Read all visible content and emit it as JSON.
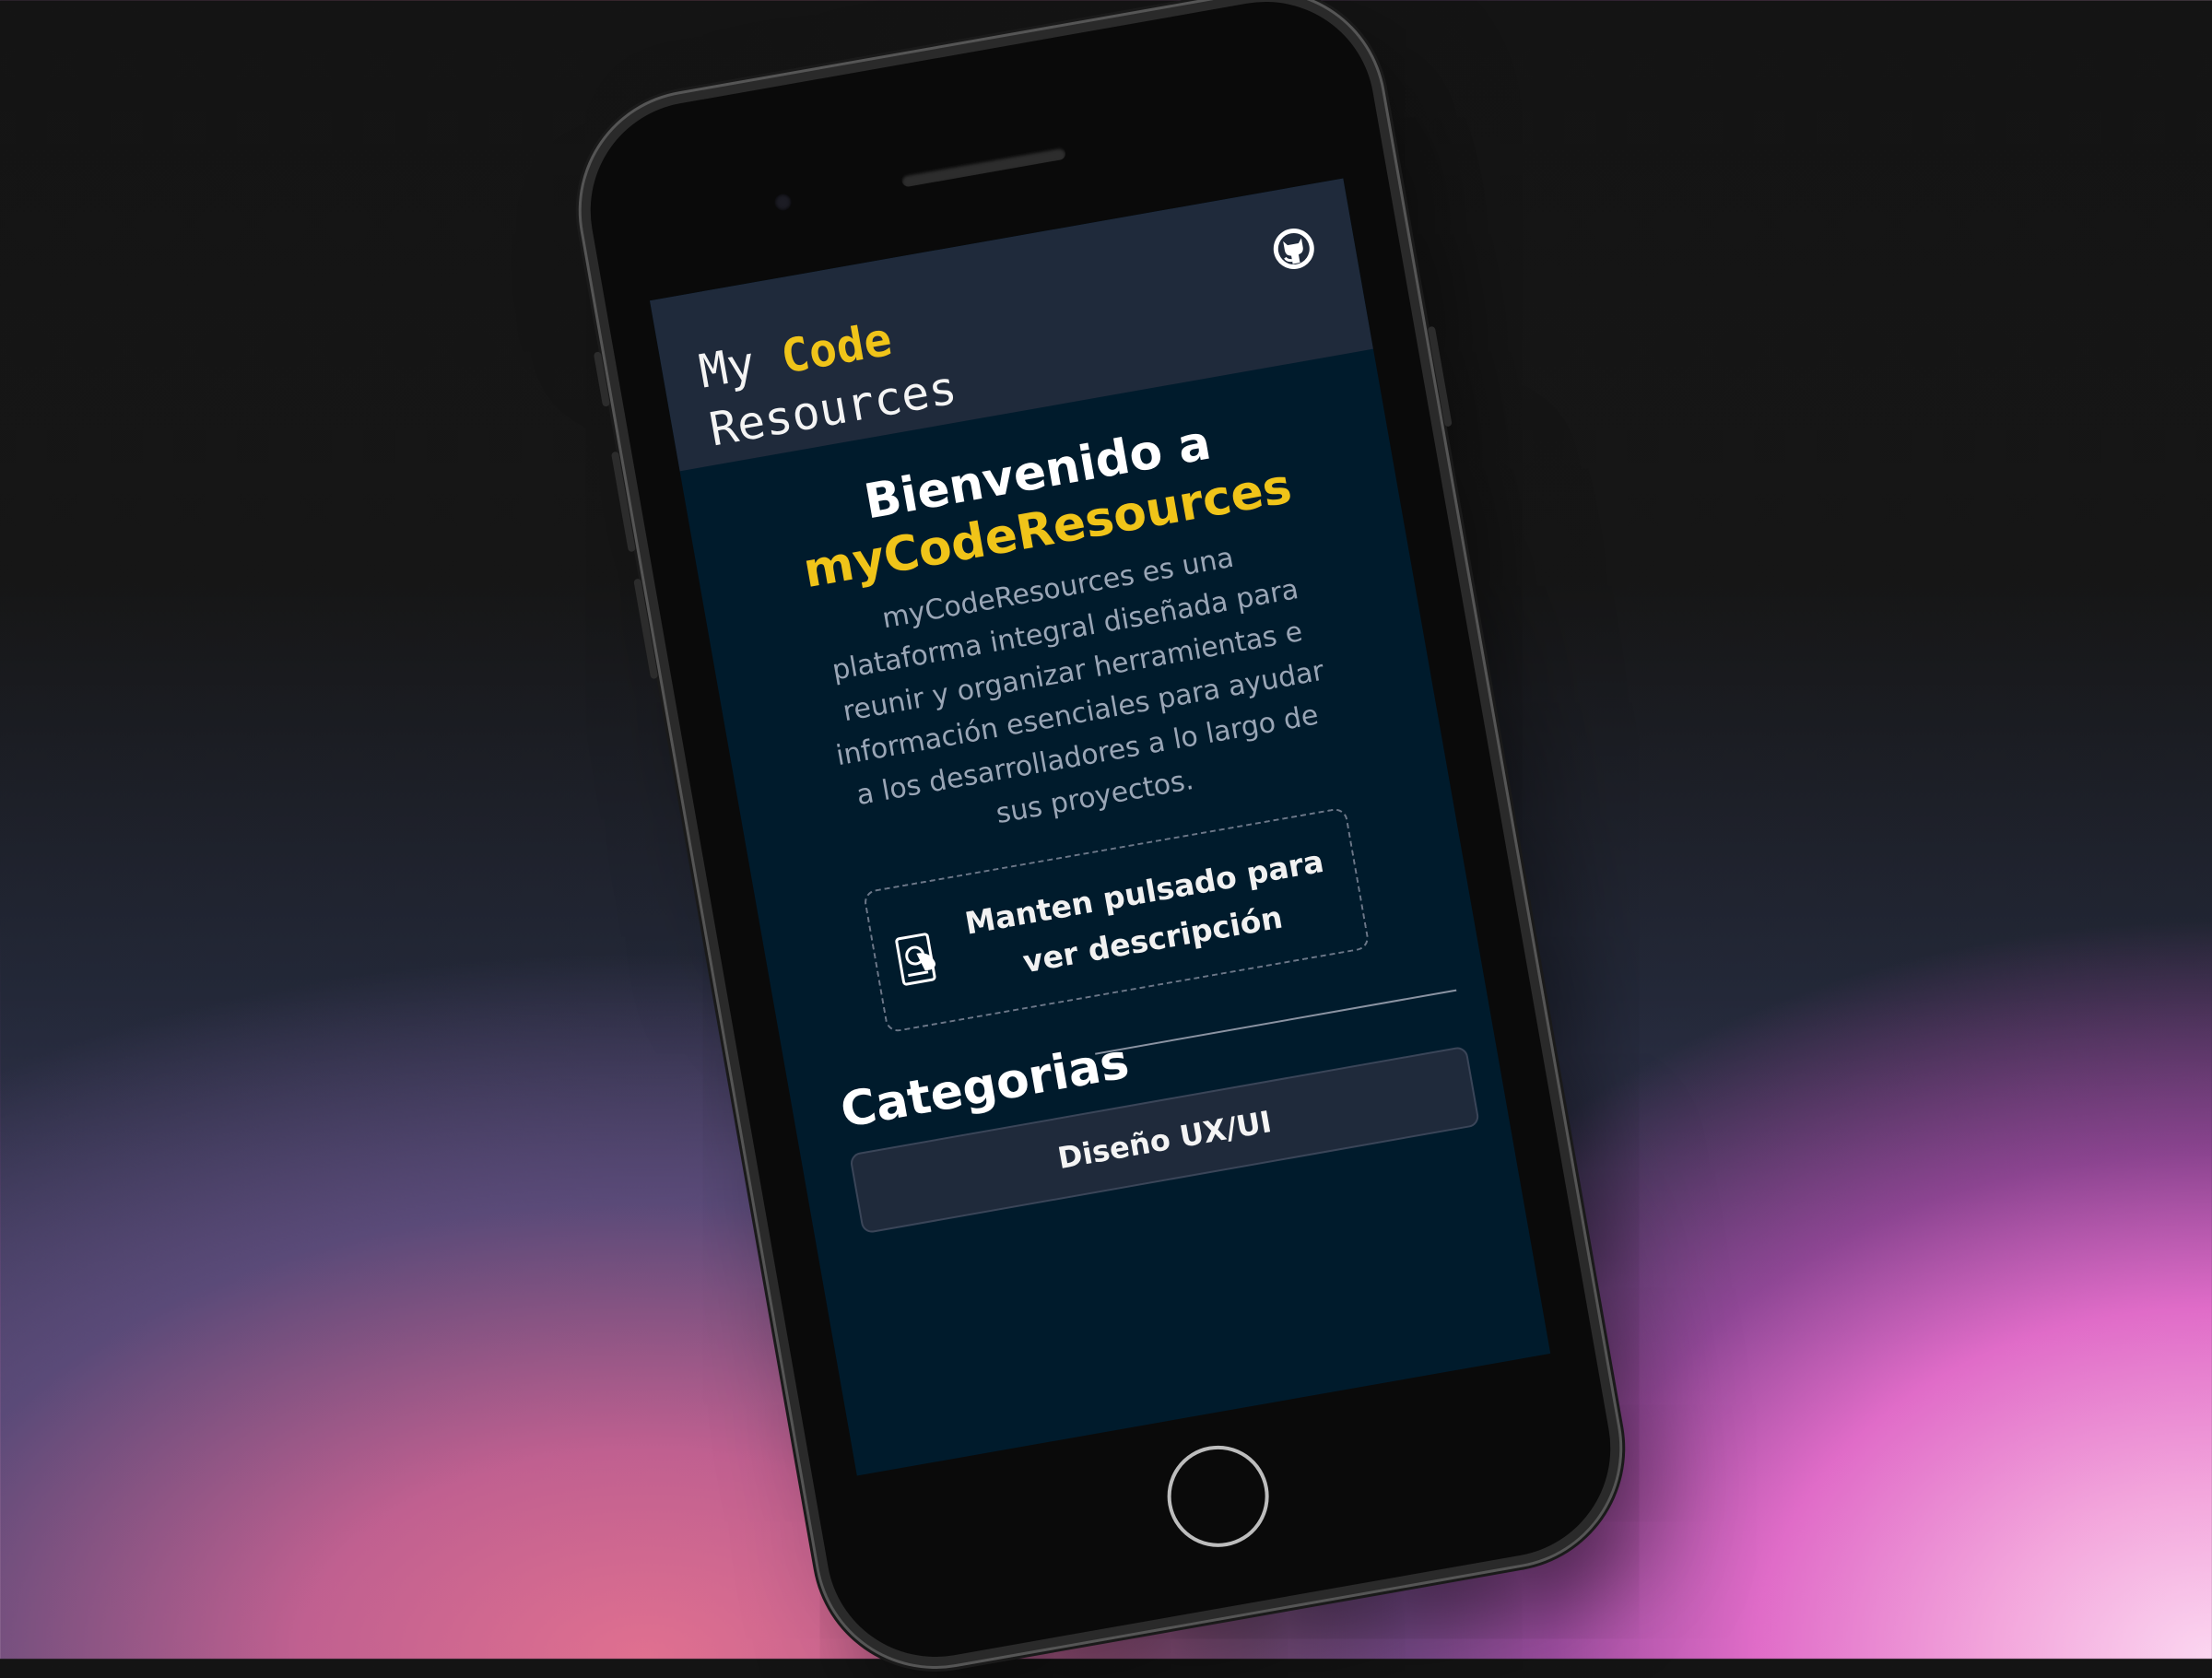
{
  "header": {
    "logo_word1": "My",
    "logo_word2": "Code",
    "logo_word3": "Resources",
    "github_icon": "github-icon"
  },
  "hero": {
    "title_line1": "Bienvenido a",
    "title_brand": "myCodeResources",
    "description": "myCodeResources es una plataforma integral diseñada para reunir y organizar herramientas e información esenciales para ayudar a los desarrolladores a lo largo de sus proyectos."
  },
  "hint": {
    "icon": "touch-hold-icon",
    "text": "Manten pulsado para ver descripción"
  },
  "categories": {
    "title": "Categorias",
    "items": [
      "Diseño UX/UI"
    ]
  },
  "colors": {
    "accent": "#f0c419",
    "header_bg": "#1f2a3b",
    "page_bg": "#001b2c"
  }
}
